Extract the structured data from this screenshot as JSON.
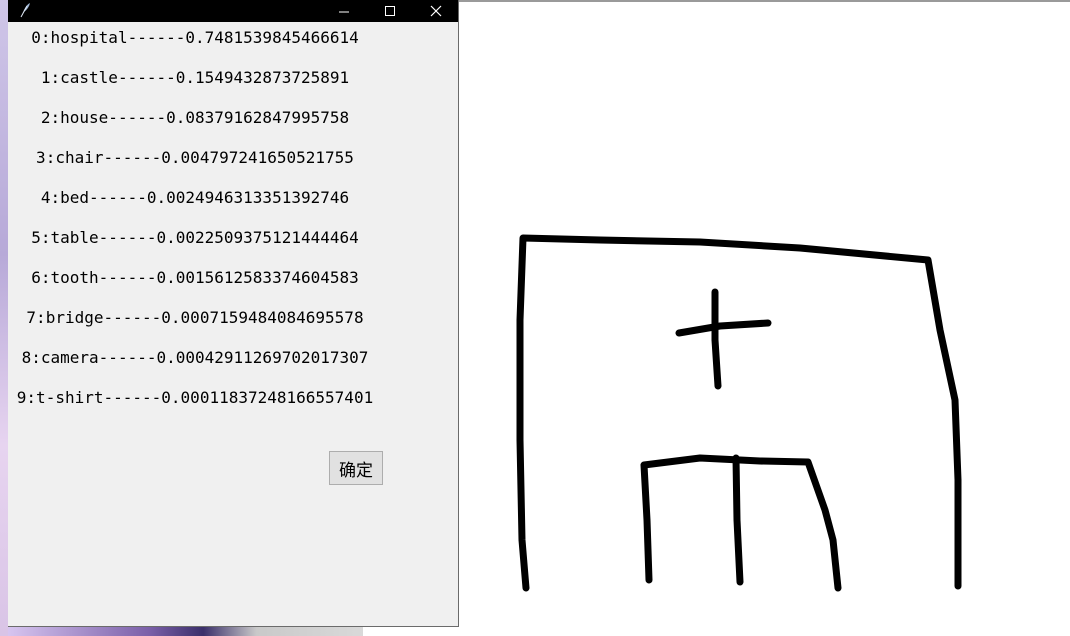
{
  "results": [
    {
      "label": "0:hospital------0.7481539845466614"
    },
    {
      "label": "1:castle------0.1549432873725891"
    },
    {
      "label": "2:house------0.08379162847995758"
    },
    {
      "label": "3:chair------0.004797241650521755"
    },
    {
      "label": "4:bed------0.0024946313351392746"
    },
    {
      "label": "5:table------0.0022509375121444464"
    },
    {
      "label": "6:tooth------0.0015612583374604583"
    },
    {
      "label": "7:bridge------0.0007159484084695578"
    },
    {
      "label": "8:camera------0.00042911269702017307"
    },
    {
      "label": "9:t-shirt------0.00011837248166557401"
    }
  ],
  "confirm_button": {
    "label": "确定"
  },
  "colors": {
    "titlebar": "#000000",
    "window_bg": "#f0f0f0",
    "stroke": "#000000"
  }
}
